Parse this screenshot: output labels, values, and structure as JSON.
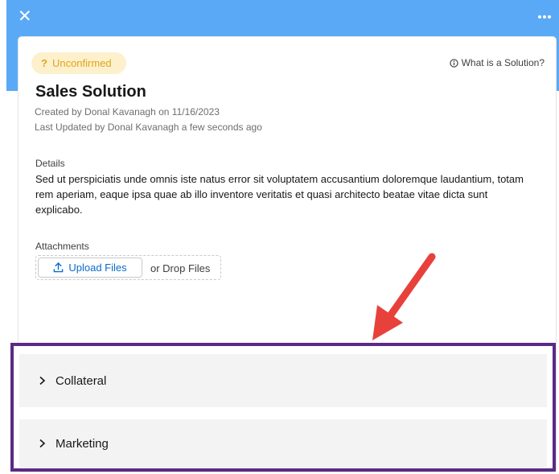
{
  "header": {
    "close_label": "✕",
    "close_icon": "close-icon",
    "more_icon": "more-dots-icon",
    "color": "#5aa9f7"
  },
  "status": {
    "icon": "question-mark-icon",
    "icon_glyph": "?",
    "label": "Unconfirmed",
    "color": "#e0a51c"
  },
  "help": {
    "icon": "info-icon",
    "label": "What is a Solution?"
  },
  "record": {
    "title": "Sales Solution",
    "created": "Created by Donal Kavanagh on 11/16/2023",
    "updated": "Last Updated by Donal Kavanagh a few seconds ago"
  },
  "details": {
    "label": "Details",
    "text": "Sed ut perspiciatis unde omnis iste natus error sit voluptatem accusantium doloremque laudantium, totam rem aperiam, eaque ipsa quae ab illo inventore veritatis et quasi architecto beatae vitae dicta sunt explicabo."
  },
  "attachments": {
    "label": "Attachments",
    "upload_icon": "upload-icon",
    "upload_label": "Upload Files",
    "drop_label": "or Drop Files"
  },
  "sections": [
    {
      "label": "Collateral",
      "icon": "chevron-right-icon"
    },
    {
      "label": "Marketing",
      "icon": "chevron-right-icon"
    }
  ],
  "annotation": {
    "arrow_color": "#e8413c",
    "highlight_color": "#5b2a86"
  }
}
